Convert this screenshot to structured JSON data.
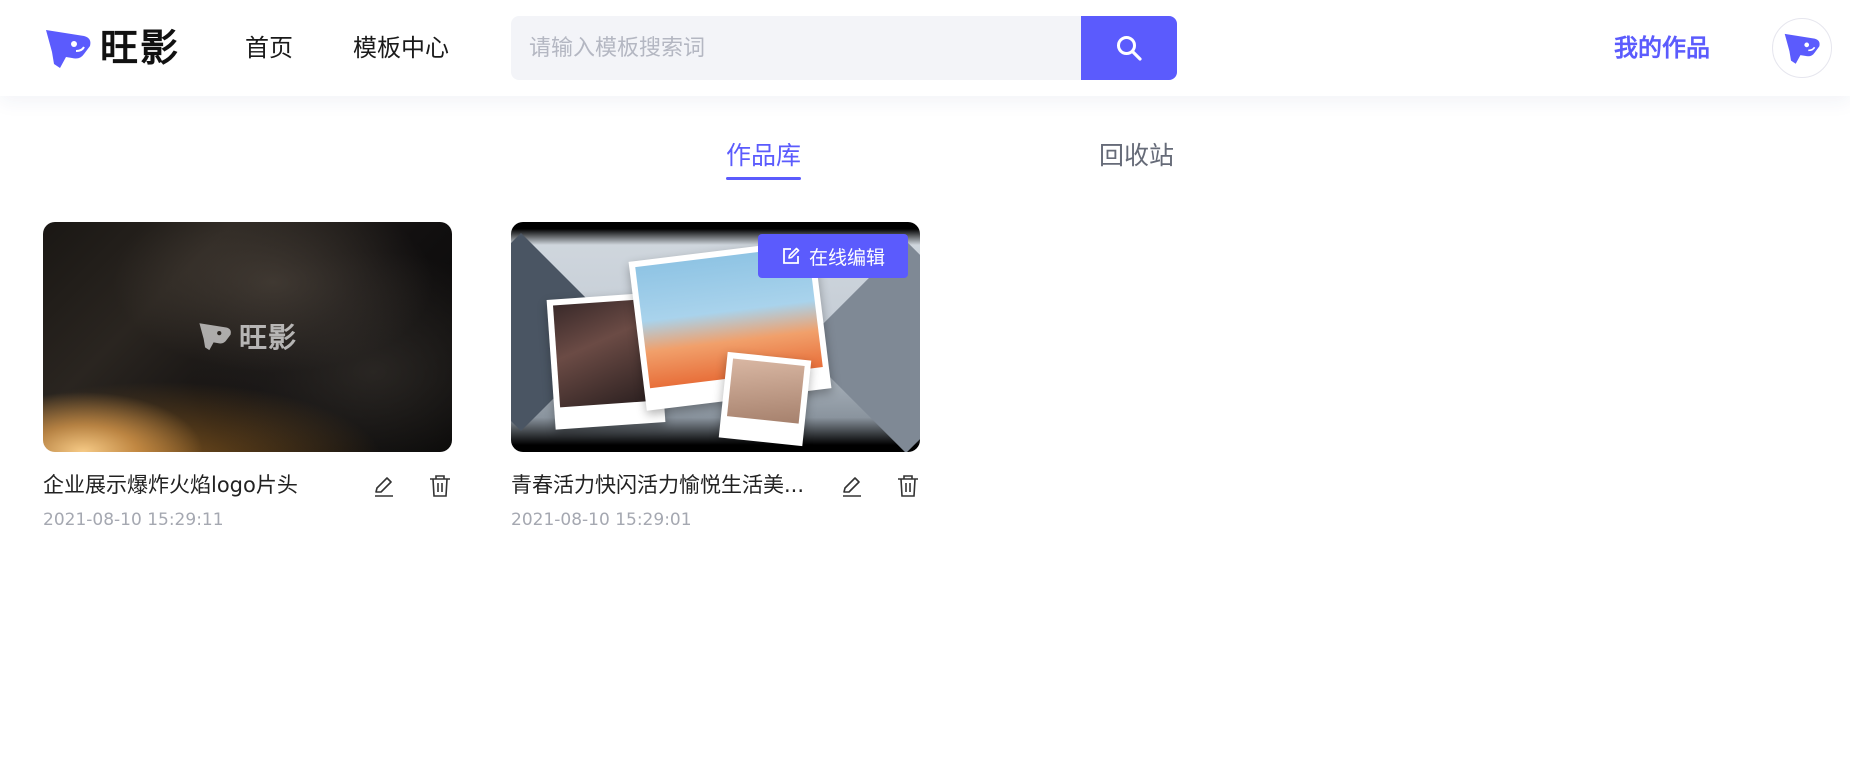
{
  "header": {
    "logo": {
      "text": "旺影",
      "icon": "wangying-logo-icon",
      "brand_color": "#5b5bfd"
    },
    "nav": [
      {
        "label": "首页"
      },
      {
        "label": "模板中心"
      }
    ],
    "search": {
      "placeholder": "请输入模板搜索词",
      "value": "",
      "button_icon": "search-icon"
    },
    "my_works_label": "我的作品",
    "avatar_icon": "wangying-avatar-icon"
  },
  "tabs": [
    {
      "label": "作品库",
      "active": true
    },
    {
      "label": "回收站",
      "active": false
    }
  ],
  "works": [
    {
      "title": "企业展示爆炸火焰logo片头",
      "date": "2021-08-10 15:29:11",
      "thumbnail_text": "旺影",
      "actions": [
        "edit-icon",
        "trash-icon"
      ]
    },
    {
      "title": "青春活力快闪活力愉悦生活美...",
      "date": "2021-08-10 15:29:01",
      "hover_button": "在线编辑",
      "actions": [
        "edit-icon",
        "trash-icon"
      ]
    }
  ],
  "colors": {
    "accent": "#5b5bfd",
    "muted_text": "#a5a8b1",
    "tab_inactive": "#666b78",
    "search_bg": "#f3f4f8"
  }
}
